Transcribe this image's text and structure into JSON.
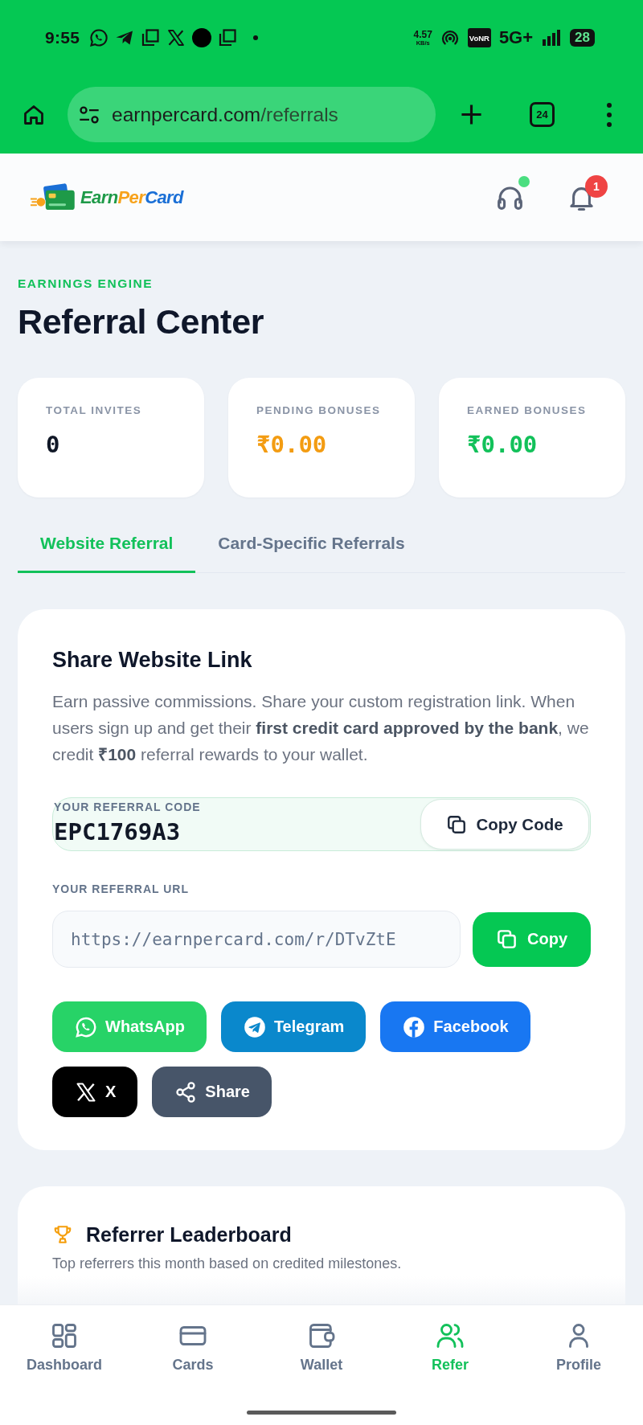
{
  "status_bar": {
    "time": "9:55",
    "speed": "4.57",
    "speed_unit": "KB/s",
    "network_badge": "VoNR",
    "network": "5G+",
    "battery": "28"
  },
  "browser": {
    "url_host": "earnpercard.com",
    "url_path": "/referrals",
    "tab_count": "24"
  },
  "header": {
    "logo": [
      "Earn",
      "Per",
      "Card"
    ],
    "support_online": true,
    "notification_count": "1"
  },
  "page": {
    "eyebrow": "EARNINGS ENGINE",
    "title": "Referral Center"
  },
  "stats": [
    {
      "label": "TOTAL INVITES",
      "value": "0",
      "color": "#111827"
    },
    {
      "label": "PENDING BONUSES",
      "value": "₹0.00",
      "color": "#f39c12"
    },
    {
      "label": "EARNED BONUSES",
      "value": "₹0.00",
      "color": "#12c15a"
    }
  ],
  "tabs": [
    {
      "label": "Website Referral",
      "selected": true
    },
    {
      "label": "Card-Specific Referrals",
      "selected": false
    }
  ],
  "share_card": {
    "title": "Share Website Link",
    "description": "Earn passive commissions. Share your custom registration link. When users sign up and get their **first credit card approved by the bank**, we credit **₹100** referral rewards to your wallet.",
    "code_label": "YOUR REFERRAL CODE",
    "code": "EPC1769A3",
    "copy_code_button": "Copy Code",
    "url_label": "YOUR REFERRAL URL",
    "url": "https://earnpercard.com/r/DTvZtE",
    "copy_button": "Copy",
    "share_buttons": [
      {
        "kind": "whatsapp",
        "label": "WhatsApp"
      },
      {
        "kind": "telegram",
        "label": "Telegram"
      },
      {
        "kind": "facebook",
        "label": "Facebook"
      },
      {
        "kind": "x",
        "label": "X"
      },
      {
        "kind": "share",
        "label": "Share"
      }
    ]
  },
  "leaderboard": {
    "title": "Referrer Leaderboard",
    "subtitle": "Top referrers this month based on credited milestones."
  },
  "bottom_nav": [
    {
      "kind": "dashboard",
      "label": "Dashboard",
      "selected": false
    },
    {
      "kind": "cards",
      "label": "Cards",
      "selected": false
    },
    {
      "kind": "wallet",
      "label": "Wallet",
      "selected": false
    },
    {
      "kind": "refer",
      "label": "Refer",
      "selected": true
    },
    {
      "kind": "profile",
      "label": "Profile",
      "selected": false
    }
  ]
}
